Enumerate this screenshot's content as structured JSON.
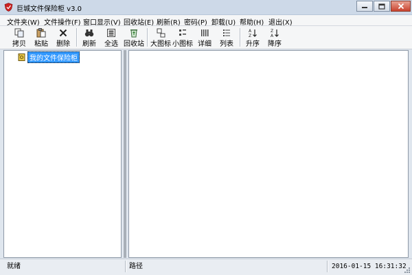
{
  "window": {
    "title": "巨城文件保险柜 v3.0",
    "icon": "shield-icon",
    "accent_color": "#cc2222"
  },
  "menu": [
    "文件夹(W)",
    "文件操作(F)",
    "窗口显示(V)",
    "回收站(E)",
    "刷新(R)",
    "密码(P)",
    "卸载(U)",
    "帮助(H)",
    "退出(X)"
  ],
  "toolbar": {
    "copy": "拷贝",
    "paste": "粘贴",
    "delete": "删除",
    "refresh": "刷新",
    "select_all": "全选",
    "recycle_bin": "回收站",
    "large_icons": "大图标",
    "small_icons": "小图标",
    "details": "详细",
    "list": "列表",
    "ascending": "升序",
    "descending": "降序"
  },
  "tree": {
    "root_label": "我的文件保险柜",
    "selected_color": "#3399ff"
  },
  "status": {
    "ready": "就绪",
    "path_label": "路径",
    "datetime": "2016-01-15 16:31:32"
  }
}
